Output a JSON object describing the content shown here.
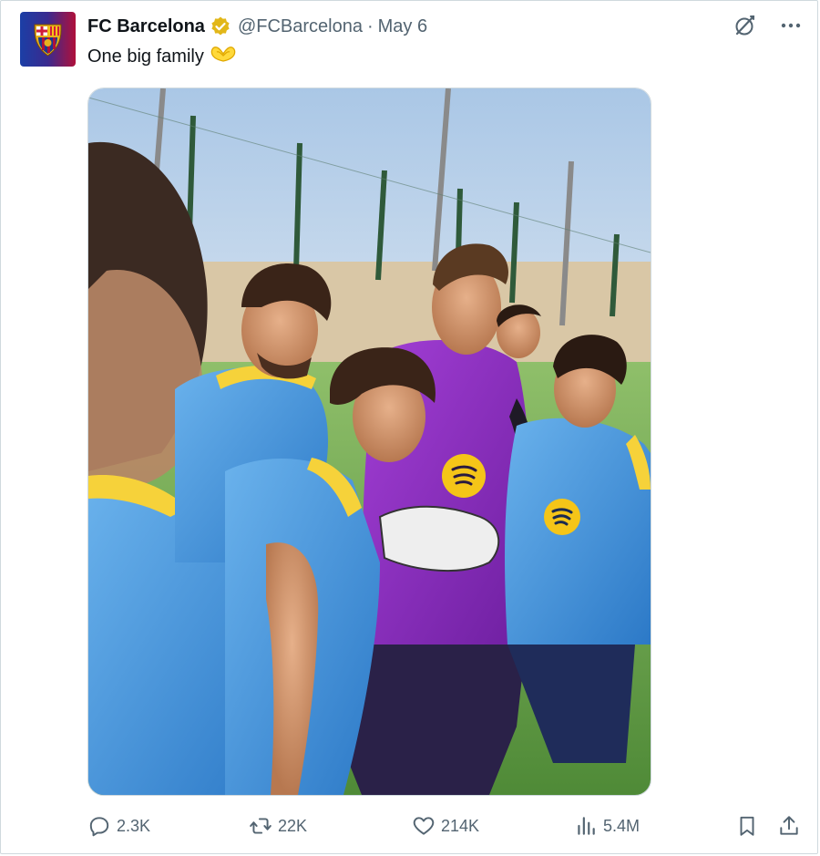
{
  "tweet": {
    "display_name": "FC Barcelona",
    "handle": "@FCBarcelona",
    "separator": "·",
    "date": "May 6",
    "text": "One big family",
    "text_emoji_icon": "heart-hands-icon",
    "verified_icon": "verified-gold-badge-icon",
    "media_description_icon": "team-photo"
  },
  "top_actions": [
    {
      "icon": "grok-icon"
    },
    {
      "icon": "more-icon"
    }
  ],
  "stats": {
    "replies": "2.3K",
    "reposts": "22K",
    "likes": "214K",
    "views": "5.4M"
  },
  "colors": {
    "text_primary": "#0f1419",
    "text_secondary": "#536471",
    "verified_gold": "#e2b719",
    "barca_blue": "#004d98",
    "barca_red": "#a50044"
  }
}
